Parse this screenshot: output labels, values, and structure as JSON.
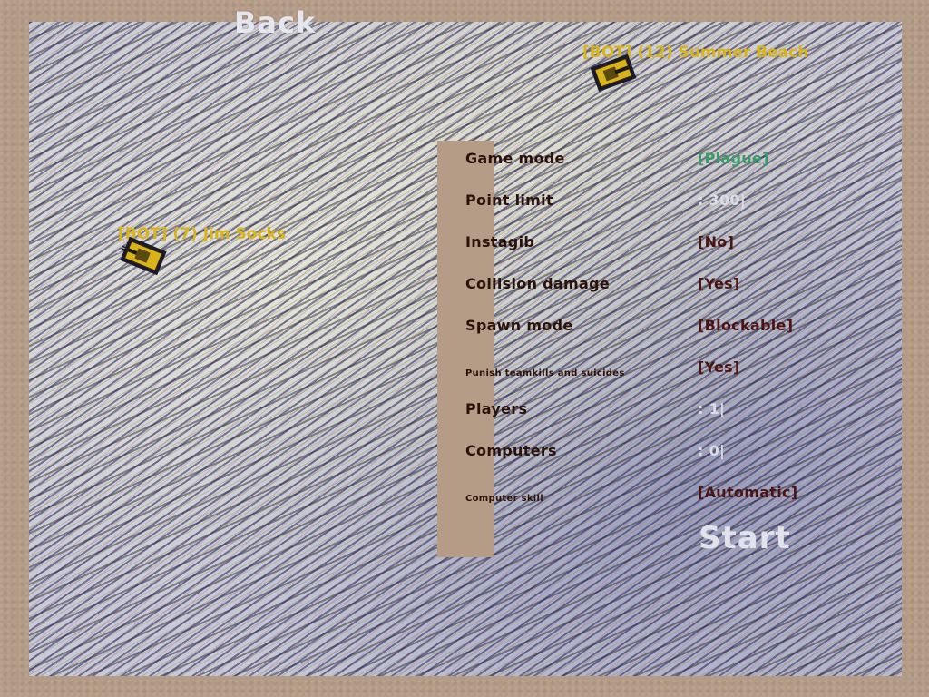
{
  "back_label": "Back",
  "players_on_field": [
    {
      "name": "[BOT] (12) Summer Beach",
      "tank_color": "#d8b31a"
    },
    {
      "name": "[BOT] (7) Jim Socks",
      "tank_color": "#d8b31a"
    }
  ],
  "options": [
    {
      "label": "Game mode",
      "value": "[Plague]"
    },
    {
      "label": "Point limit",
      "value": ": 300|"
    },
    {
      "label": "Instagib",
      "value": "[No]"
    },
    {
      "label": "Collision damage",
      "value": "[Yes]"
    },
    {
      "label": "Spawn mode",
      "value": "[Blockable]"
    },
    {
      "label": "Punish teamkills and suicides",
      "value": "[Yes]"
    },
    {
      "label": "Players",
      "value": ": 1|"
    },
    {
      "label": "Computers",
      "value": ": 0|"
    },
    {
      "label": "Computer skill",
      "value": "[Automatic]"
    }
  ],
  "start_label": "Start",
  "colors": {
    "label": "#2a1208",
    "value": "#4a1412",
    "selected_value": "#3a9a6a",
    "input_value": "#dcdce6",
    "bot_name": "#d8b31a",
    "frame": "#b39b86"
  }
}
